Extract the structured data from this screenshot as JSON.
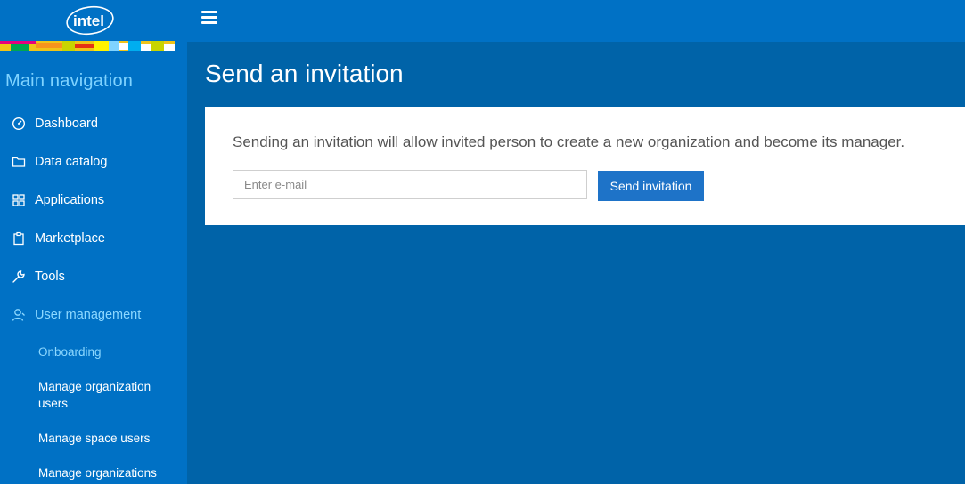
{
  "brand": {
    "logo_text": "intel"
  },
  "topbar": {
    "menu_icon": "hamburger-icon"
  },
  "sidebar": {
    "title": "Main navigation",
    "items": [
      {
        "label": "Dashboard",
        "icon": "gauge-icon"
      },
      {
        "label": "Data catalog",
        "icon": "folder-icon"
      },
      {
        "label": "Applications",
        "icon": "grid-icon"
      },
      {
        "label": "Marketplace",
        "icon": "clipboard-icon"
      },
      {
        "label": "Tools",
        "icon": "wrench-icon"
      },
      {
        "label": "User management",
        "icon": "user-icon"
      }
    ],
    "subitems": [
      {
        "label": "Onboarding"
      },
      {
        "label": "Manage organization users"
      },
      {
        "label": "Manage space users"
      },
      {
        "label": "Manage organizations"
      }
    ]
  },
  "main": {
    "title": "Send an invitation",
    "description": "Sending an invitation will allow invited person to create a new organization and become its manager.",
    "email": {
      "placeholder": "Enter e-mail",
      "value": ""
    },
    "send_button": "Send invitation"
  },
  "colors": {
    "sidebar_bg": "#0071c5",
    "content_bg": "#0063a8",
    "accent_text": "#8cd8ff",
    "button_bg": "#1e73c8"
  }
}
